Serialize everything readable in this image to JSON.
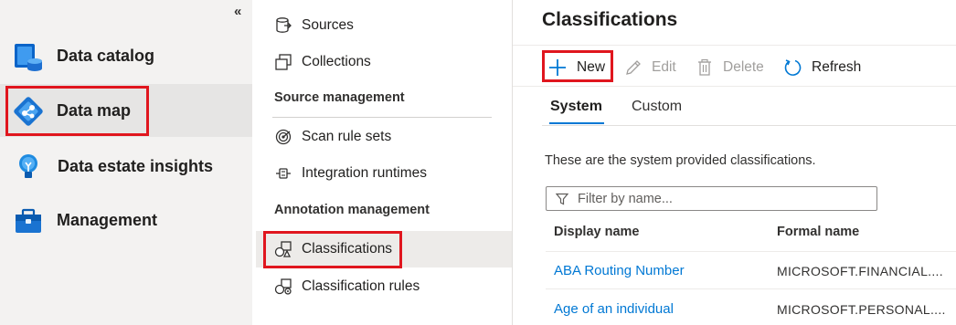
{
  "left_nav": {
    "collapse_glyph": "«",
    "items": [
      {
        "label": "Data catalog",
        "icon": "data-catalog-icon"
      },
      {
        "label": "Data map",
        "icon": "data-map-icon",
        "selected": true
      },
      {
        "label": "Data estate insights",
        "icon": "lightbulb-icon"
      },
      {
        "label": "Management",
        "icon": "toolbox-icon"
      }
    ]
  },
  "mid_nav": {
    "items": [
      {
        "label": "Sources",
        "icon": "sources-icon"
      },
      {
        "label": "Collections",
        "icon": "collections-icon"
      }
    ],
    "section_source": "Source management",
    "source_items": [
      {
        "label": "Scan rule sets",
        "icon": "scan-rule-icon"
      },
      {
        "label": "Integration runtimes",
        "icon": "integration-runtime-icon"
      }
    ],
    "section_annotation": "Annotation management",
    "annotation_items": [
      {
        "label": "Classifications",
        "icon": "classifications-icon",
        "selected": true
      },
      {
        "label": "Classification rules",
        "icon": "classification-rules-icon"
      }
    ]
  },
  "main": {
    "title": "Classifications",
    "toolbar": {
      "new_label": "New",
      "edit_label": "Edit",
      "delete_label": "Delete",
      "refresh_label": "Refresh"
    },
    "tabs": [
      {
        "label": "System",
        "active": true
      },
      {
        "label": "Custom"
      }
    ],
    "description": "These are the system provided classifications.",
    "filter_placeholder": "Filter by name...",
    "table": {
      "columns": [
        "Display name",
        "Formal name"
      ],
      "rows": [
        {
          "display_name": "ABA Routing Number",
          "formal_name": "MICROSOFT.FINANCIAL...."
        },
        {
          "display_name": "Age of an individual",
          "formal_name": "MICROSOFT.PERSONAL...."
        }
      ]
    }
  },
  "colors": {
    "accent": "#0078d4",
    "highlight": "#e0161e",
    "nav_background": "#f3f2f1"
  }
}
